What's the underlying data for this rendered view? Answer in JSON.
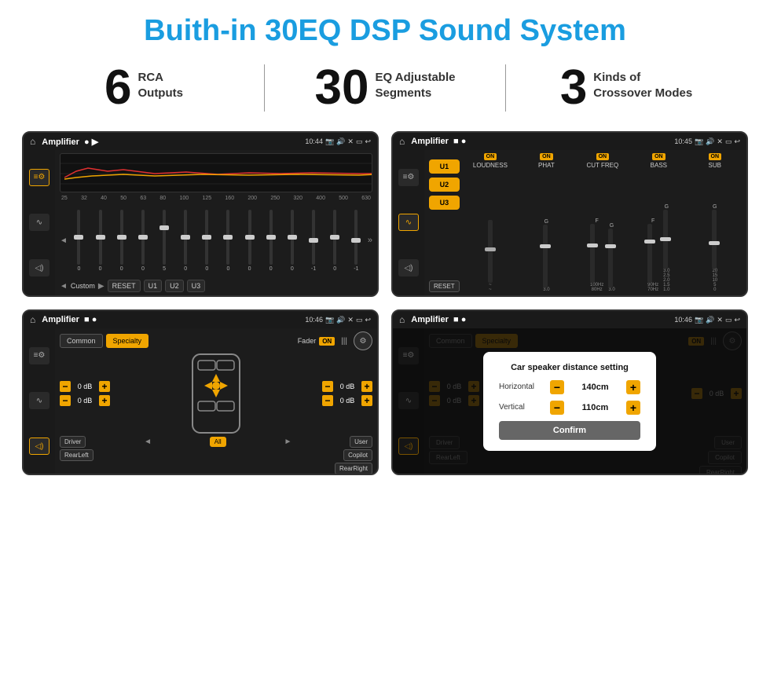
{
  "page": {
    "title": "Buith-in 30EQ DSP Sound System"
  },
  "stats": [
    {
      "number": "6",
      "label": "RCA\nOutputs"
    },
    {
      "number": "30",
      "label": "EQ Adjustable\nSegments"
    },
    {
      "number": "3",
      "label": "Kinds of\nCrossover Modes"
    }
  ],
  "screens": [
    {
      "id": "eq-screen",
      "statusBar": {
        "title": "Amplifier",
        "time": "10:44"
      },
      "type": "eq"
    },
    {
      "id": "crossover-screen",
      "statusBar": {
        "title": "Amplifier",
        "time": "10:45"
      },
      "type": "crossover"
    },
    {
      "id": "fader-screen",
      "statusBar": {
        "title": "Amplifier",
        "time": "10:46"
      },
      "type": "fader"
    },
    {
      "id": "dialog-screen",
      "statusBar": {
        "title": "Amplifier",
        "time": "10:46"
      },
      "type": "dialog"
    }
  ],
  "eq": {
    "freqLabels": [
      "25",
      "32",
      "40",
      "50",
      "63",
      "80",
      "100",
      "125",
      "160",
      "200",
      "250",
      "320",
      "400",
      "500",
      "630"
    ],
    "values": [
      "0",
      "0",
      "0",
      "0",
      "5",
      "0",
      "0",
      "0",
      "0",
      "0",
      "0",
      "0",
      "0",
      "-1",
      "0",
      "-1"
    ],
    "presets": [
      "Custom"
    ],
    "buttons": [
      "RESET",
      "U1",
      "U2",
      "U3"
    ]
  },
  "crossover": {
    "presets": [
      "U1",
      "U2",
      "U3"
    ],
    "resetBtn": "RESET",
    "channels": [
      {
        "label": "LOUDNESS",
        "on": true
      },
      {
        "label": "PHAT",
        "on": true
      },
      {
        "label": "CUT FREQ",
        "on": true
      },
      {
        "label": "BASS",
        "on": true
      },
      {
        "label": "SUB",
        "on": true
      }
    ]
  },
  "fader": {
    "tabs": [
      "Common",
      "Specialty"
    ],
    "activeTab": "Specialty",
    "faderLabel": "Fader",
    "onLabel": "ON",
    "dbValues": [
      "0 dB",
      "0 dB",
      "0 dB",
      "0 dB"
    ],
    "buttons": [
      "Driver",
      "Copilot",
      "RearLeft",
      "All",
      "User",
      "RearRight"
    ]
  },
  "dialog": {
    "title": "Car speaker distance setting",
    "horizontalLabel": "Horizontal",
    "horizontalValue": "140cm",
    "verticalLabel": "Vertical",
    "verticalValue": "110cm",
    "confirmBtn": "Confirm",
    "fader": {
      "tabs": [
        "Common",
        "Specialty"
      ],
      "activeTab": "Specialty",
      "onLabel": "ON",
      "dbValues": [
        "0 dB",
        "0 dB"
      ]
    }
  },
  "icons": {
    "home": "⌂",
    "back": "↩",
    "location": "📍",
    "camera": "📷",
    "volume": "🔊",
    "close": "✕",
    "minus": "−",
    "plus": "+"
  }
}
